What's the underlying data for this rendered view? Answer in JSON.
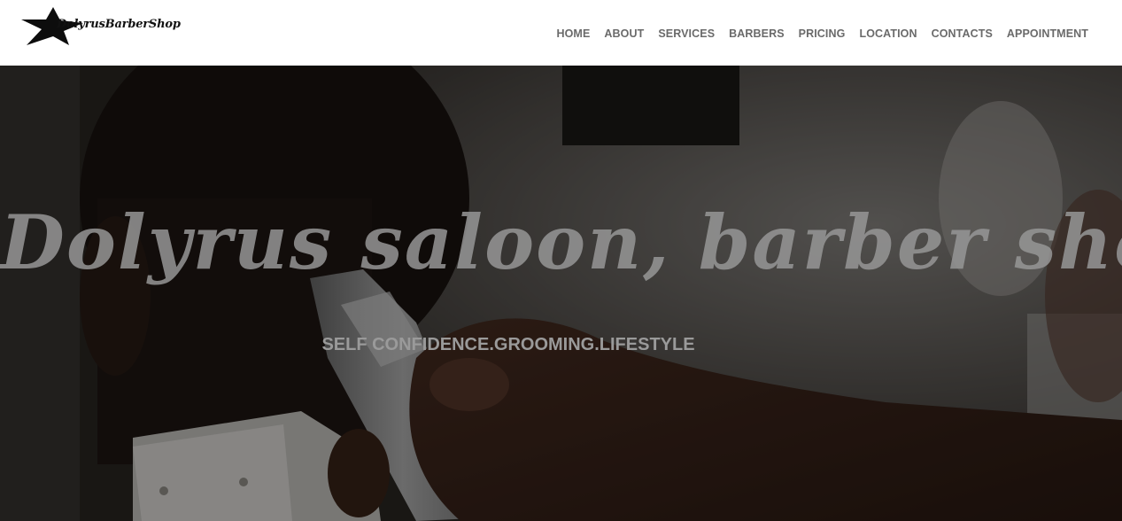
{
  "header": {
    "logo_text": "DolyrusBarberShop",
    "logo_icon": "star-icon"
  },
  "nav": {
    "items": [
      {
        "label": "HOME"
      },
      {
        "label": "ABOUT"
      },
      {
        "label": "SERVICES"
      },
      {
        "label": "BARBERS"
      },
      {
        "label": "PRICING"
      },
      {
        "label": "LOCATION"
      },
      {
        "label": "CONTACTS"
      },
      {
        "label": "APPOINTMENT"
      }
    ]
  },
  "hero": {
    "title": "Dolyrus saloon, barber shop",
    "subtitle": "SELF CONFIDENCE.GROOMING.LIFESTYLE"
  },
  "colors": {
    "nav_text": "#6a6a6a",
    "header_bg": "#ffffff",
    "hero_title": "#969696",
    "hero_subtitle": "#9a9a9a"
  }
}
